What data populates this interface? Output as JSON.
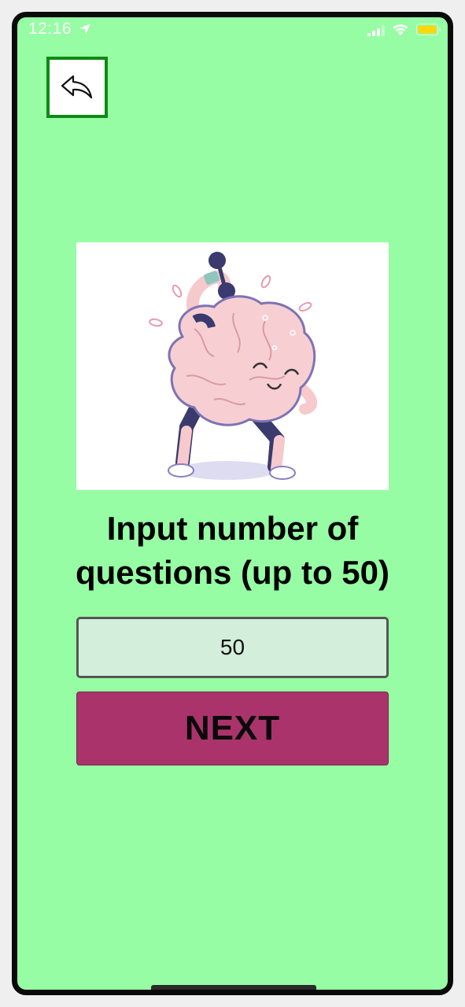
{
  "status_bar": {
    "time": "12:16",
    "location_icon": "location-arrow-icon",
    "signal_icon": "cellular-signal-icon",
    "wifi_icon": "wifi-icon",
    "battery_icon": "battery-icon",
    "battery_color": "#ffd60a"
  },
  "back_button": {
    "icon": "reply-arrow-icon",
    "border_color": "#0e8a14"
  },
  "hero_image": {
    "icon": "brain-lifting-dumbbell-illustration"
  },
  "prompt": {
    "title": "Input number of questions (up to 50)"
  },
  "count_input": {
    "value": "50"
  },
  "next_button": {
    "label": "NEXT",
    "color": "#ab336b"
  },
  "colors": {
    "background": "#96fda4",
    "input_background": "#d3efdb"
  }
}
